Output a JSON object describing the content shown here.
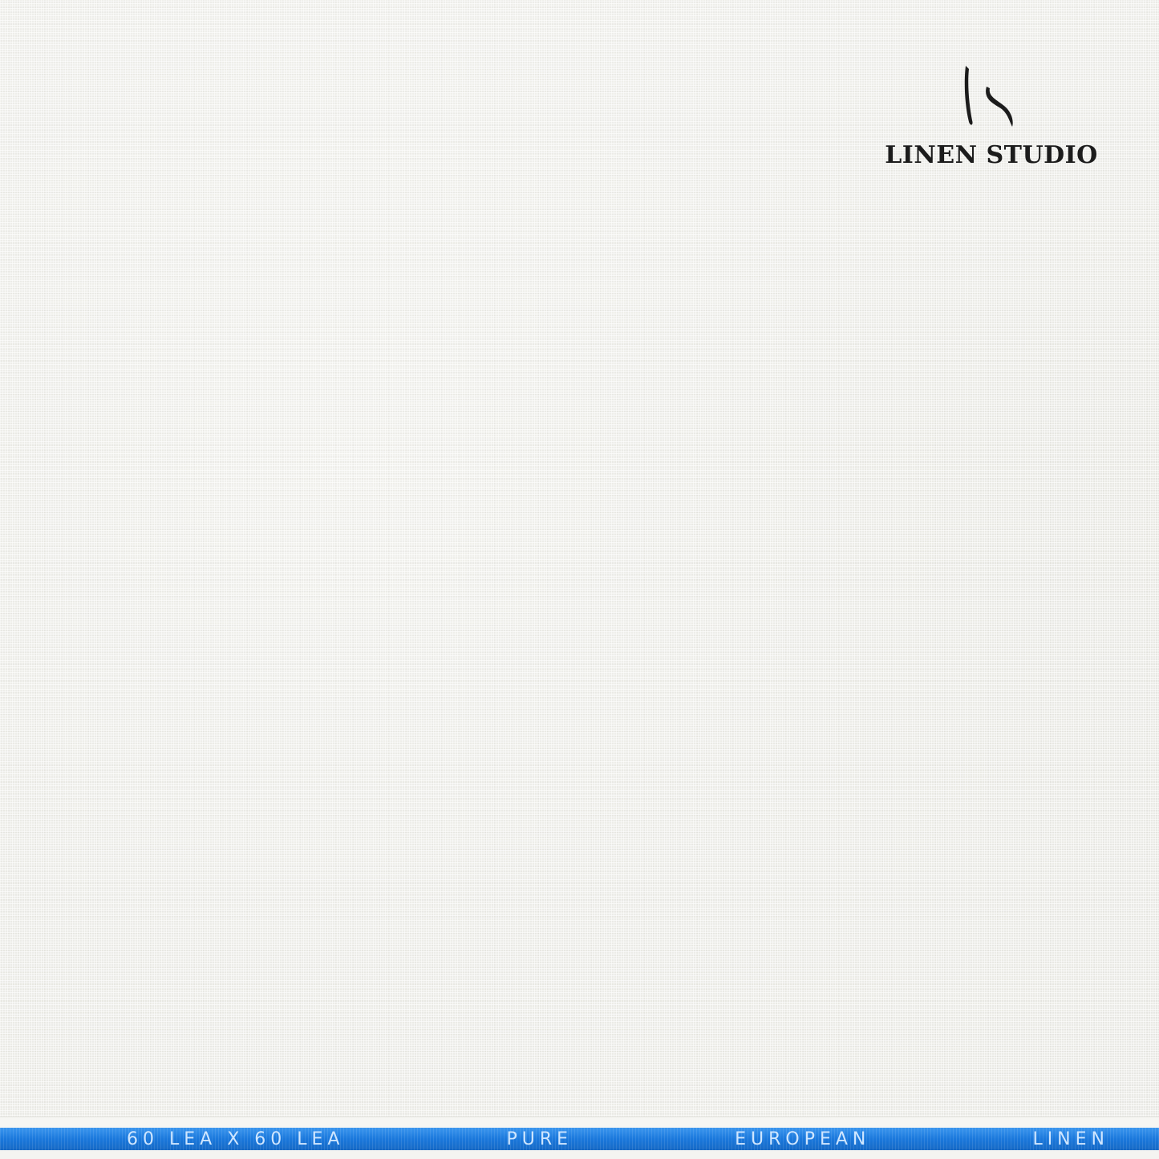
{
  "brand": {
    "name": "LINEN STUDIO",
    "monogram_icon": "ls-monogram-icon",
    "text_color": "#1c1c1c"
  },
  "fabric": {
    "base_color": "#eeeeea"
  },
  "selvedge": {
    "band_color": "#1e7fe0",
    "text_color": "#cfe6ff",
    "words": [
      "60 LEA X 60 LEA",
      "PURE",
      "EUROPEAN",
      "LINEN"
    ]
  }
}
